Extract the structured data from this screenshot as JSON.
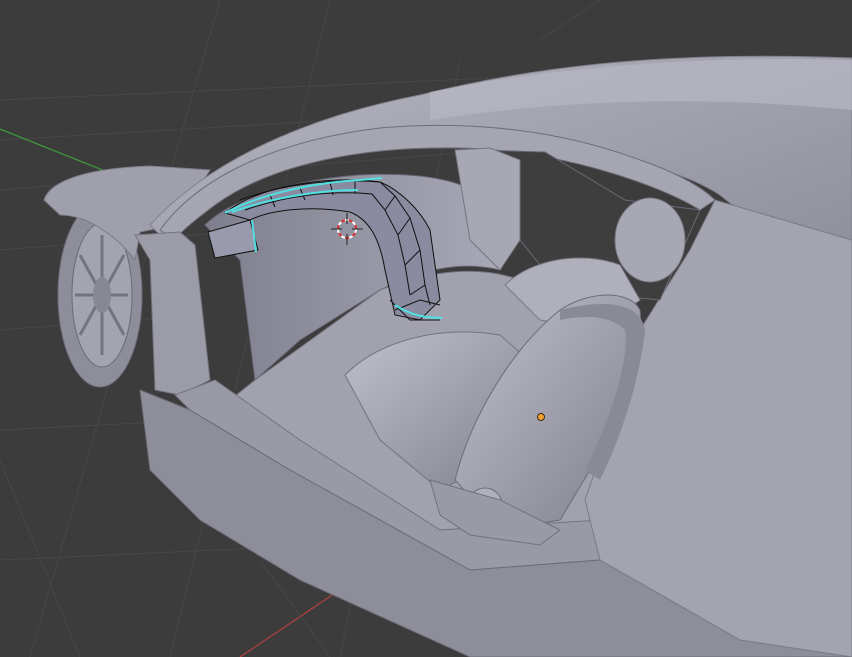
{
  "viewport": {
    "background_color": "#3c3c3c",
    "grid_color": "#4a4a4a",
    "x_axis_color": "#b04040",
    "y_axis_color": "#40a040"
  },
  "model": {
    "body_color": "#9a9aa6",
    "shadow_color": "#6c6c78",
    "highlight_color": "#b4b4c0",
    "wire_color": "#111111",
    "selection_color": "#4fe0e0"
  },
  "cursor": {
    "icon": "3d-cursor-icon",
    "ring_color_a": "#d83030",
    "ring_color_b": "#ffffff"
  },
  "origin": {
    "icon": "object-origin-icon",
    "color": "#f0a030"
  }
}
